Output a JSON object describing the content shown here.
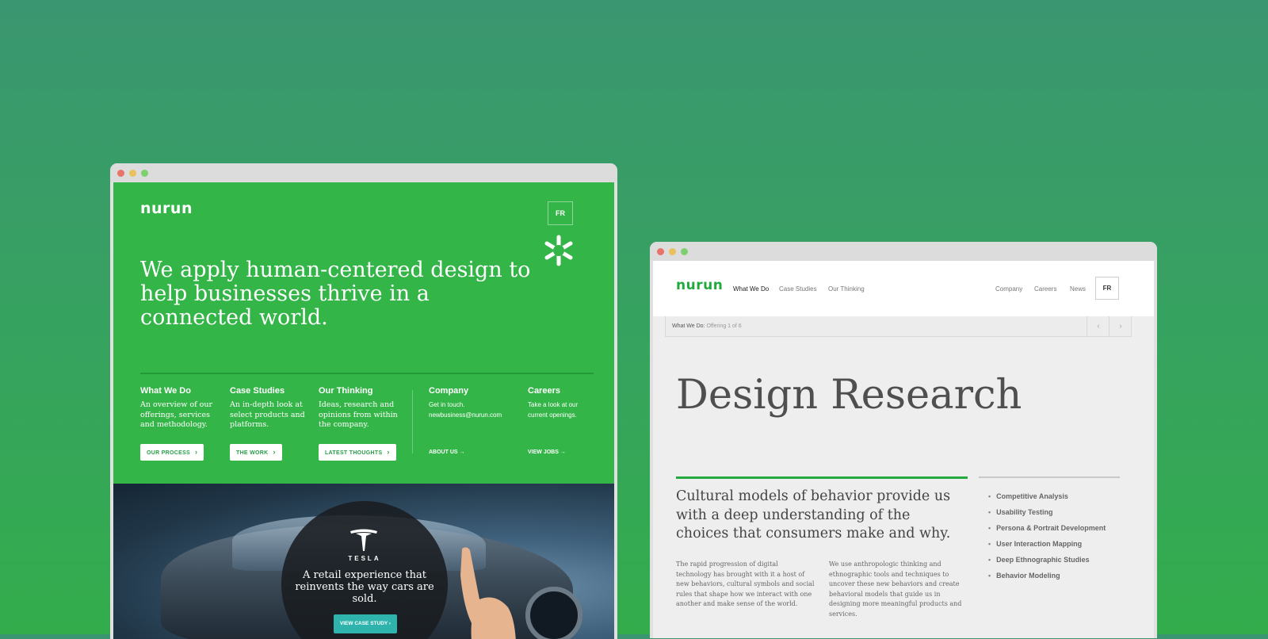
{
  "left_window": {
    "logo": "nurun",
    "lang_button": "FR",
    "hero": "We apply human-centered design to help businesses thrive in a connected world.",
    "columns": [
      {
        "title": "What We Do",
        "text": "An overview of our offerings, services and methodology.",
        "button": "OUR PROCESS"
      },
      {
        "title": "Case Studies",
        "text": "An in-depth look at select products and platforms.",
        "button": "THE WORK"
      },
      {
        "title": "Our Thinking",
        "text": "Ideas, research and opinions from within the company.",
        "button": "LATEST THOUGHTS"
      },
      {
        "title": "Company",
        "text": "Get in touch.",
        "email": "newbusiness@nurun.com",
        "link": "ABOUT US"
      },
      {
        "title": "Careers",
        "text": "Take a look at our current openings.",
        "link": "VIEW JOBS"
      }
    ],
    "promo": {
      "brand": "TESLA",
      "headline": "A retail experience that reinvents the way cars are sold.",
      "cta": "VIEW CASE STUDY"
    }
  },
  "right_window": {
    "logo": "nurun",
    "nav_left": [
      "What We Do",
      "Case Studies",
      "Our Thinking"
    ],
    "nav_right": [
      "Company",
      "Careers",
      "News"
    ],
    "lang_button": "FR",
    "breadcrumb": {
      "label": "What We Do:",
      "value": "Offering 1 of 6"
    },
    "title": "Design Research",
    "lead": "Cultural models of behavior provide us with a deep understanding of the choices that consumers make and why.",
    "body": [
      "The rapid progression of digital technology has brought with it a host of new behaviors, cultural symbols and social rules that shape how we interact with one another and make sense of the world.",
      "We use anthropologic thinking and ethnographic tools and techniques to uncover these new behaviors and create behavioral models that guide us in designing more meaningful products and services."
    ],
    "services": [
      "Competitive Analysis",
      "Usability Testing",
      "Persona & Portrait Development",
      "User Interaction Mapping",
      "Deep Ethnographic Studies",
      "Behavior Modeling"
    ]
  },
  "colors": {
    "background_top": "#3a9670",
    "background_bottom": "#33ad4c",
    "brand_green": "#34b548",
    "logo_green": "#22aa3d",
    "teal_cta": "#2fb4ad"
  },
  "icons": [
    "window-close-dot",
    "window-minimize-dot",
    "window-zoom-dot",
    "asterisk-logo-icon",
    "chevron-right-icon",
    "arrow-right-icon",
    "tesla-logo-icon"
  ]
}
